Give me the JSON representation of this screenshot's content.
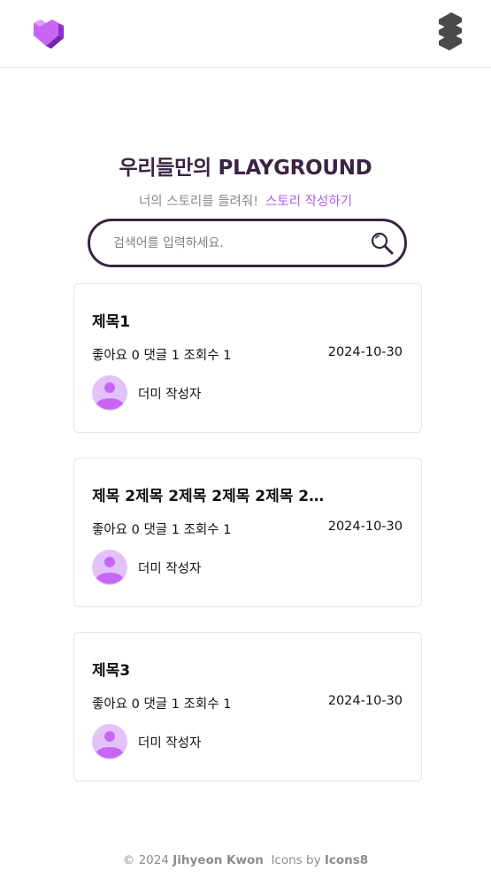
{
  "header": {
    "logo_icon": "pixel-heart-icon",
    "menu_icon": "menu-stack-icon"
  },
  "hero": {
    "title": "우리들만의 PLAYGROUND",
    "subtitle": "너의 스토리를 들려줘!",
    "write_link": "스토리 작성하기"
  },
  "search": {
    "placeholder": "검색어를 입력하세요.",
    "value": "",
    "icon": "search-icon"
  },
  "posts": [
    {
      "title": "제목1",
      "stats": "좋아요 0 댓글 1 조회수 1",
      "date": "2024-10-30",
      "author": "더미 작성자"
    },
    {
      "title": "제목 2제목 2제목 2제목 2제목 2…",
      "stats": "좋아요 0 댓글 1 조회수 1",
      "date": "2024-10-30",
      "author": "더미 작성자"
    },
    {
      "title": "제목3",
      "stats": "좋아요 0 댓글 1 조회수 1",
      "date": "2024-10-30",
      "author": "더미 작성자"
    }
  ],
  "footer": {
    "copyright": "© 2024",
    "author": "Jihyeon Kwon",
    "icons_by": "Icons by",
    "icons_source": "Icons8"
  },
  "colors": {
    "accent": "#b05ee8",
    "title": "#3b2443",
    "border": "#3a2442",
    "avatar": "#d9a6f5"
  }
}
